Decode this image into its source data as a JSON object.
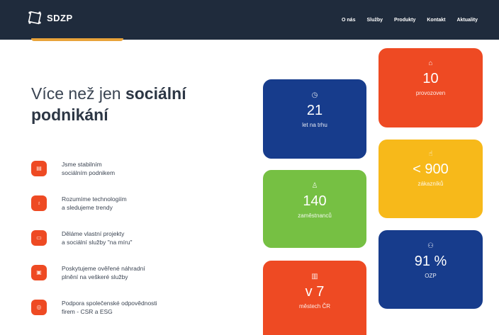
{
  "header": {
    "logo_text": "SDZP",
    "nav": [
      "O nás",
      "Služby",
      "Produkty",
      "Kontakt",
      "Aktuality"
    ]
  },
  "hero": {
    "title_regular": "Více než jen ",
    "title_bold_1": "sociální",
    "title_bold_2": "podnikání"
  },
  "features": [
    {
      "icon": "document-icon",
      "line1": "Jsme stabilním",
      "line2": "sociálním podnikem"
    },
    {
      "icon": "bulb-icon",
      "line1": "Rozumíme technologiím",
      "line2": "a sledujeme trendy"
    },
    {
      "icon": "folder-icon",
      "line1": "Děláme vlastní projekty",
      "line2": "a sociální služby \"na míru\""
    },
    {
      "icon": "calendar-icon",
      "line1": "Poskytujeme ověřené náhradní",
      "line2": "plnění na veškeré služby"
    },
    {
      "icon": "check-circle-icon",
      "line1": "Podpora společenské odpovědnosti",
      "line2": "firem - CSR a ESG"
    }
  ],
  "stats": {
    "years": {
      "value": "21",
      "label": "let na trhu",
      "icon": "clock-icon",
      "color": "#173c8c"
    },
    "locations": {
      "value": "10",
      "label": "provozoven",
      "icon": "home-icon",
      "color": "#ee4a23"
    },
    "employees": {
      "value": "140",
      "label": "zaměstnanců",
      "icon": "user-add-icon",
      "color": "#76c043"
    },
    "customers": {
      "value": "< 900",
      "label": "zákazníků",
      "icon": "thumbs-up-icon",
      "color": "#f7b91a"
    },
    "cities": {
      "value": "v 7",
      "label": "městech ČR",
      "icon": "city-icon",
      "color": "#ee4a23"
    },
    "ozp": {
      "value": "91 %",
      "label": "OZP",
      "icon": "users-icon",
      "color": "#173c8c"
    }
  },
  "colors": {
    "header_bg": "#1f2b3c",
    "accent_orange": "#ee4a23",
    "accent_gold": "#e8a33a",
    "text_dark": "#3a4452"
  }
}
